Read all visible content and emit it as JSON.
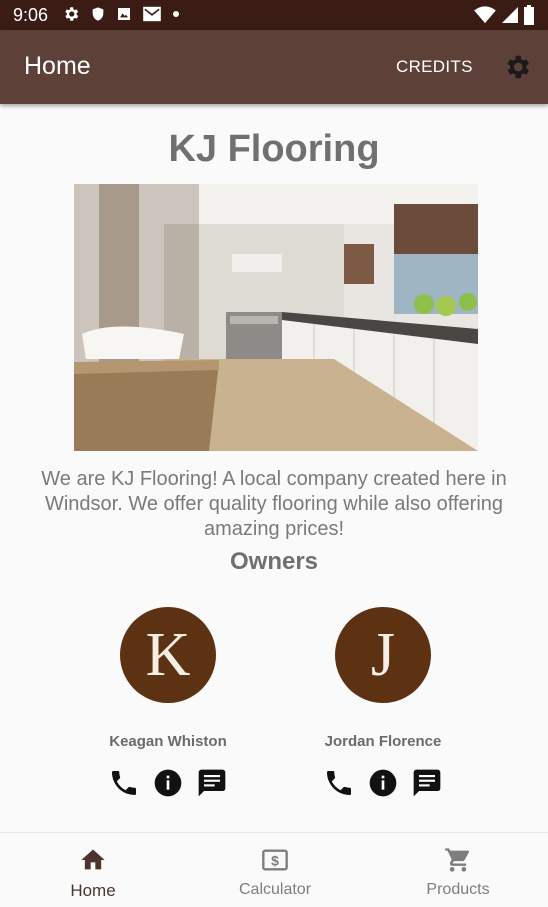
{
  "status_bar": {
    "time": "9:06"
  },
  "app_bar": {
    "title": "Home",
    "credits_label": "CREDITS"
  },
  "company": {
    "name": "KJ Flooring",
    "about": "We are KJ Flooring! A local company created here in Windsor. We offer quality flooring while also offering amazing prices!"
  },
  "owners": {
    "heading": "Owners",
    "people": [
      {
        "initial": "K",
        "name": "Keagan Whiston"
      },
      {
        "initial": "J",
        "name": "Jordan Florence"
      }
    ]
  },
  "bottom_nav": {
    "items": [
      {
        "label": "Home",
        "icon": "home-icon",
        "active": true
      },
      {
        "label": "Calculator",
        "icon": "calculator-icon",
        "active": false
      },
      {
        "label": "Products",
        "icon": "cart-icon",
        "active": false
      }
    ]
  },
  "colors": {
    "app_bar": "#5d4037",
    "status_bar": "#3a1c15",
    "avatar": "#5d3212"
  }
}
